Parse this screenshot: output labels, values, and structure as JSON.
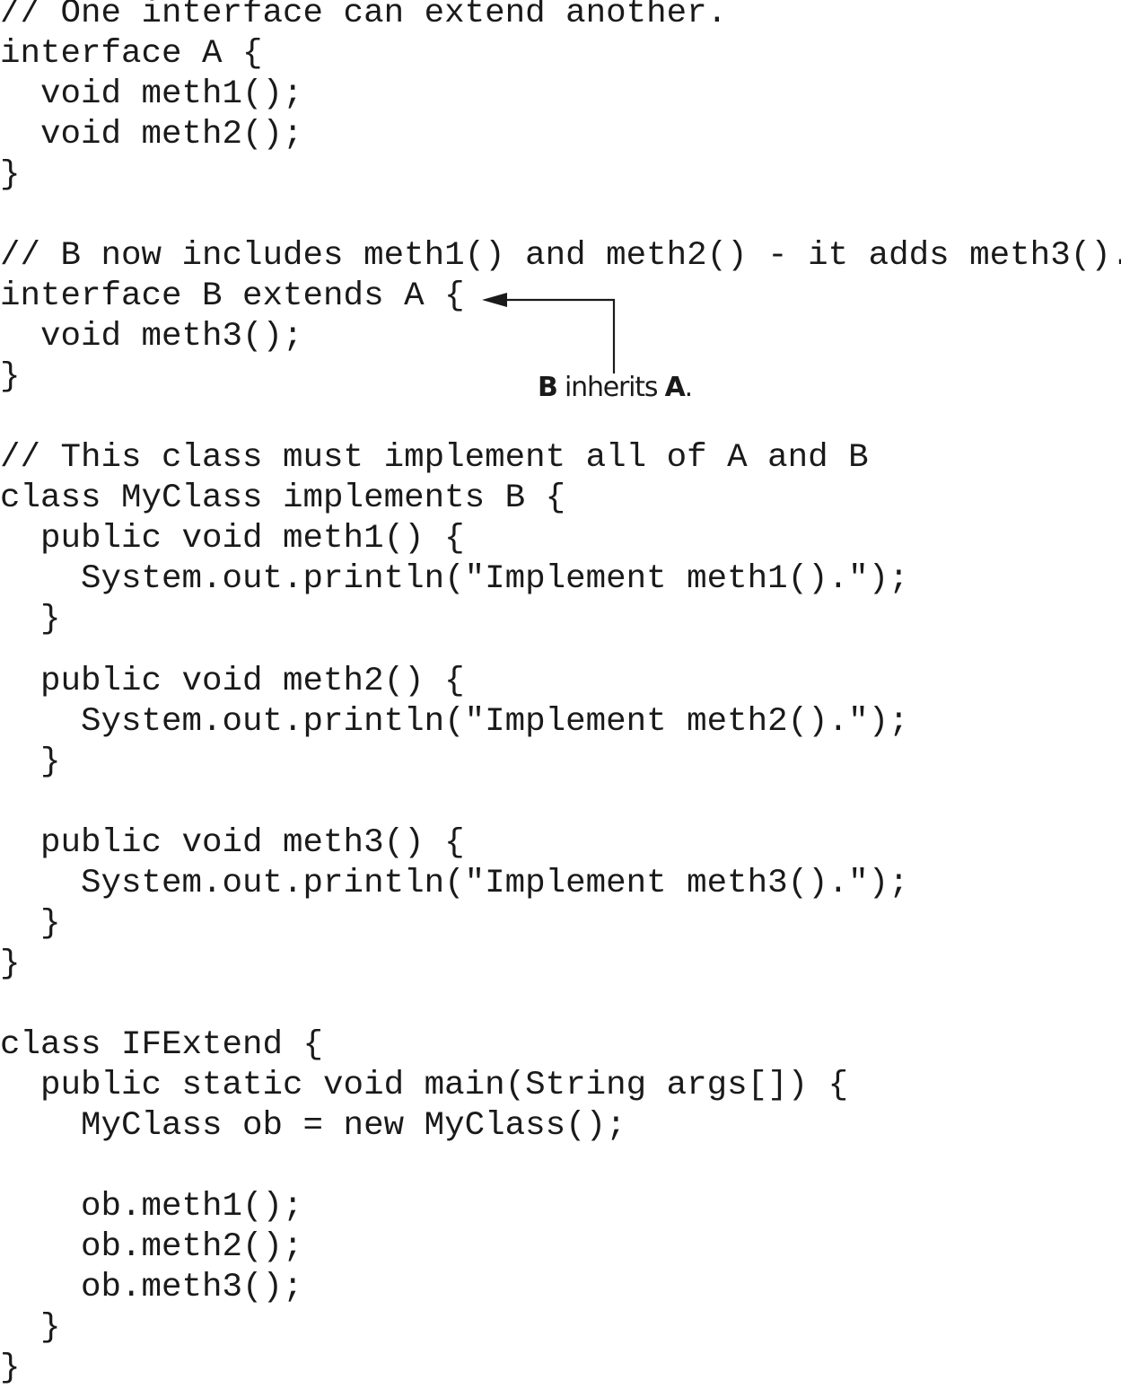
{
  "code_lines": [
    "// One interface can extend another.",
    "interface A {",
    "  void meth1();",
    "  void meth2();",
    "}",
    "// B now includes meth1() and meth2() - it adds meth3().",
    "interface B extends A {",
    "  void meth3();",
    "}",
    "// This class must implement all of A and B",
    "class MyClass implements B {",
    "  public void meth1() {",
    "    System.out.println(\"Implement meth1().\");",
    "  }",
    "  public void meth2() {",
    "    System.out.println(\"Implement meth2().\");",
    "  }",
    "  public void meth3() {",
    "    System.out.println(\"Implement meth3().\");",
    "  }",
    "}",
    "class IFExtend {",
    "  public static void main(String args[]) {",
    "    MyClass ob = new MyClass();",
    "    ob.meth1();",
    "    ob.meth2();",
    "    ob.meth3();",
    "  }",
    "}"
  ],
  "callout": {
    "subject": "B",
    "verb": " inherits ",
    "object": "A",
    "period": "."
  }
}
